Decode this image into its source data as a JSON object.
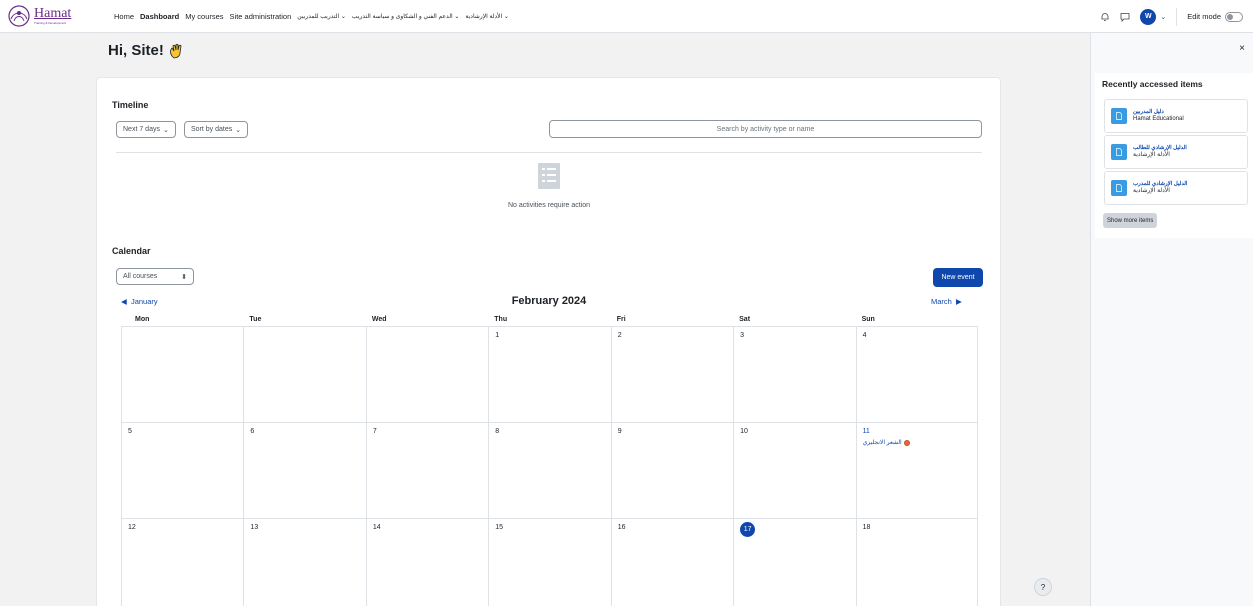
{
  "brand": {
    "name": "Hamat",
    "tagline": "Training & Development"
  },
  "nav": {
    "items": [
      {
        "label": "Home",
        "active": false
      },
      {
        "label": "Dashboard",
        "active": true
      },
      {
        "label": "My courses",
        "active": false
      },
      {
        "label": "Site administration",
        "active": false
      }
    ],
    "arabic_menus": [
      "التدريب للمدربين",
      "الدعم الفني و الشكاوى و سياسة التدريب",
      "الأدلة الإرشادية"
    ],
    "user_initials": "W",
    "edit_mode_label": "Edit mode"
  },
  "greeting": "Hi, Site!",
  "timeline": {
    "heading": "Timeline",
    "filter_label": "Next 7 days",
    "sort_label": "Sort by dates",
    "search_placeholder": "Search by activity type or name",
    "empty_message": "No activities require action"
  },
  "calendar": {
    "heading": "Calendar",
    "course_select": "All courses",
    "new_event_label": "New event",
    "prev_month": "January",
    "next_month": "March",
    "month_title": "February 2024",
    "weekdays": [
      "Mon",
      "Tue",
      "Wed",
      "Thu",
      "Fri",
      "Sat",
      "Sun"
    ],
    "weeks": [
      [
        "",
        "",
        "",
        "1",
        "2",
        "3",
        "4"
      ],
      [
        "5",
        "6",
        "7",
        "8",
        "9",
        "10",
        "11"
      ],
      [
        "12",
        "13",
        "14",
        "15",
        "16",
        "17",
        "18"
      ]
    ],
    "today": "17",
    "event_day": "11",
    "event_label": "الشعر الانجليزي"
  },
  "drawer": {
    "title": "Recently accessed items",
    "items": [
      {
        "title": "دليل المدربين",
        "subtitle": "Hamat Educational"
      },
      {
        "title": "الدليل الإرشادي للطالب",
        "subtitle": "الأدلة الإرشادية"
      },
      {
        "title": "الدليل الإرشادي للمدرب",
        "subtitle": "الأدلة الإرشادية"
      }
    ],
    "show_more_label": "Show more items",
    "close_glyph": "×"
  },
  "help_glyph": "?",
  "colors": {
    "primary": "#0f47ad",
    "brand": "#6a2c8a",
    "event_dot": "#e8663c"
  }
}
